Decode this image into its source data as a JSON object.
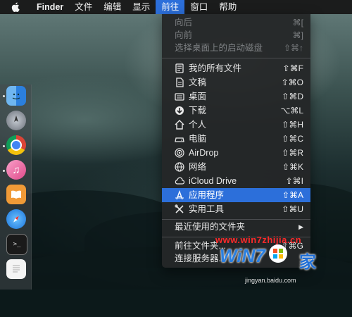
{
  "menubar": {
    "app": "Finder",
    "items": [
      "文件",
      "编辑",
      "显示",
      "前往",
      "窗口",
      "帮助"
    ]
  },
  "menu": {
    "back": {
      "label": "向后",
      "shortcut": "⌘["
    },
    "forward": {
      "label": "向前",
      "shortcut": "⌘]"
    },
    "startup_disk": {
      "label": "选择桌面上的启动磁盘",
      "shortcut": "⇧⌘↑"
    },
    "places": [
      {
        "label": "我的所有文件",
        "shortcut": "⇧⌘F",
        "icon": "all-files-icon"
      },
      {
        "label": "文稿",
        "shortcut": "⇧⌘O",
        "icon": "documents-icon"
      },
      {
        "label": "桌面",
        "shortcut": "⇧⌘D",
        "icon": "desktop-icon"
      },
      {
        "label": "下载",
        "shortcut": "⌥⌘L",
        "icon": "downloads-icon"
      },
      {
        "label": "个人",
        "shortcut": "⇧⌘H",
        "icon": "home-icon"
      },
      {
        "label": "电脑",
        "shortcut": "⇧⌘C",
        "icon": "computer-icon"
      },
      {
        "label": "AirDrop",
        "shortcut": "⇧⌘R",
        "icon": "airdrop-icon"
      },
      {
        "label": "网络",
        "shortcut": "⇧⌘K",
        "icon": "network-icon"
      },
      {
        "label": "iCloud Drive",
        "shortcut": "⇧⌘I",
        "icon": "icloud-icon"
      },
      {
        "label": "应用程序",
        "shortcut": "⇧⌘A",
        "icon": "applications-icon"
      },
      {
        "label": "实用工具",
        "shortcut": "⇧⌘U",
        "icon": "utilities-icon"
      }
    ],
    "recent_folders": {
      "label": "最近使用的文件夹",
      "arrow": "▶"
    },
    "goto_folder": {
      "label": "前往文件夹...",
      "shortcut": "⇧⌘G"
    },
    "connect_server": {
      "label": "连接服务器..."
    }
  },
  "dock": [
    "finder-icon",
    "launchpad-icon",
    "chrome-icon",
    "itunes-icon",
    "ibooks-icon",
    "safari-icon",
    "terminal-icon",
    "textedit-icon"
  ],
  "watermark": {
    "url": "www.win7zhijia.cn",
    "logo": "WiN7",
    "logo_cn": "家",
    "sub": "jingyan.baidu.com"
  },
  "colors": {
    "highlight": "#2c6fda",
    "menubar": "#1b1c1c",
    "menu_bg": "#242628"
  }
}
